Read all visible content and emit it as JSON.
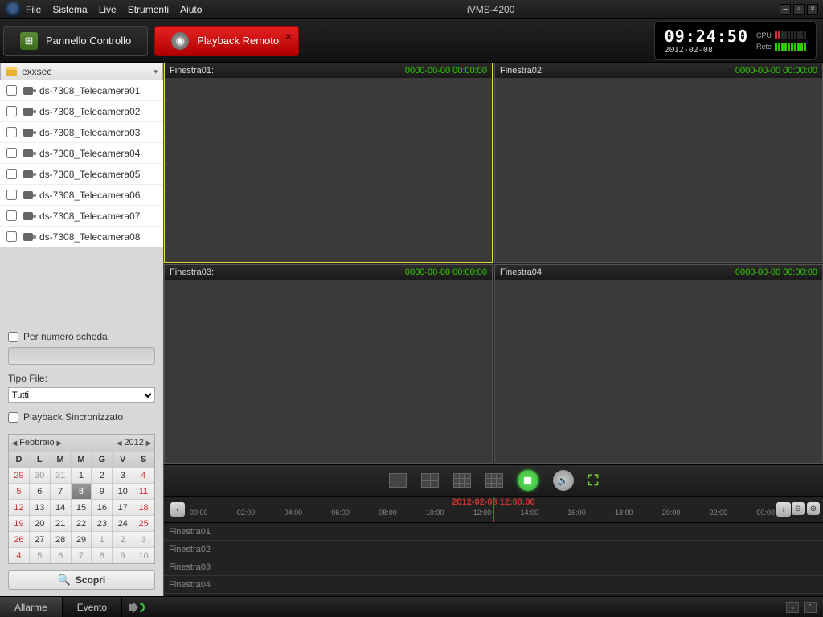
{
  "app": {
    "title": "iVMS-4200"
  },
  "menu": [
    "File",
    "Sistema",
    "Live",
    "Strumenti",
    "Aiuto"
  ],
  "tabs": {
    "control": "Pannello Controllo",
    "playback": "Playback Remoto"
  },
  "clock": {
    "time": "09:24:50",
    "date": "2012-02-08",
    "cpu": "CPU",
    "net": "Rete"
  },
  "sidebar": {
    "group": "exxsec",
    "cameras": [
      "ds-7308_Telecamera01",
      "ds-7308_Telecamera02",
      "ds-7308_Telecamera03",
      "ds-7308_Telecamera04",
      "ds-7308_Telecamera05",
      "ds-7308_Telecamera06",
      "ds-7308_Telecamera07",
      "ds-7308_Telecamera08"
    ],
    "byCard": "Per numero scheda.",
    "fileTypeLabel": "Tipo File:",
    "fileTypeValue": "Tutti",
    "syncPlayback": "Playback Sincronizzato",
    "calendar": {
      "month": "Febbraio",
      "year": "2012",
      "dow": [
        "D",
        "L",
        "M",
        "M",
        "G",
        "V",
        "S"
      ],
      "cells": [
        {
          "n": "29",
          "c": "dim sun"
        },
        {
          "n": "30",
          "c": "dim"
        },
        {
          "n": "31",
          "c": "dim"
        },
        {
          "n": "1"
        },
        {
          "n": "2"
        },
        {
          "n": "3"
        },
        {
          "n": "4",
          "c": "sun"
        },
        {
          "n": "5",
          "c": "sun"
        },
        {
          "n": "6"
        },
        {
          "n": "7"
        },
        {
          "n": "8",
          "c": "sel"
        },
        {
          "n": "9"
        },
        {
          "n": "10"
        },
        {
          "n": "11",
          "c": "sun"
        },
        {
          "n": "12",
          "c": "sun"
        },
        {
          "n": "13"
        },
        {
          "n": "14"
        },
        {
          "n": "15"
        },
        {
          "n": "16"
        },
        {
          "n": "17"
        },
        {
          "n": "18",
          "c": "sun"
        },
        {
          "n": "19",
          "c": "sun"
        },
        {
          "n": "20"
        },
        {
          "n": "21"
        },
        {
          "n": "22"
        },
        {
          "n": "23"
        },
        {
          "n": "24"
        },
        {
          "n": "25",
          "c": "sun"
        },
        {
          "n": "26",
          "c": "sun"
        },
        {
          "n": "27"
        },
        {
          "n": "28"
        },
        {
          "n": "29"
        },
        {
          "n": "1",
          "c": "dim"
        },
        {
          "n": "2",
          "c": "dim"
        },
        {
          "n": "3",
          "c": "dim"
        },
        {
          "n": "4",
          "c": "dim sun"
        },
        {
          "n": "5",
          "c": "dim"
        },
        {
          "n": "6",
          "c": "dim"
        },
        {
          "n": "7",
          "c": "dim"
        },
        {
          "n": "8",
          "c": "dim"
        },
        {
          "n": "9",
          "c": "dim"
        },
        {
          "n": "10",
          "c": "dim"
        }
      ]
    },
    "search": "Scopri"
  },
  "panes": [
    {
      "title": "Finestra01:",
      "ts": "0000-00-00 00:00:00",
      "sel": true
    },
    {
      "title": "Finestra02:",
      "ts": "0000-00-00 00:00:00"
    },
    {
      "title": "Finestra03:",
      "ts": "0000-00-00 00:00:00"
    },
    {
      "title": "Finestra04:",
      "ts": "0000-00-00 00:00:00"
    }
  ],
  "timeline": {
    "center": "2012-02-08 12:00:00",
    "ticks": [
      "00:00",
      "02:00",
      "04:00",
      "06:00",
      "08:00",
      "10:00",
      "12:00",
      "14:00",
      "16:00",
      "18:00",
      "20:00",
      "22:00",
      "00:00"
    ],
    "rows": [
      "Finestra01",
      "Finestra02",
      "Finestra03",
      "Finestra04"
    ]
  },
  "status": {
    "alarm": "Allarme",
    "event": "Evento"
  }
}
